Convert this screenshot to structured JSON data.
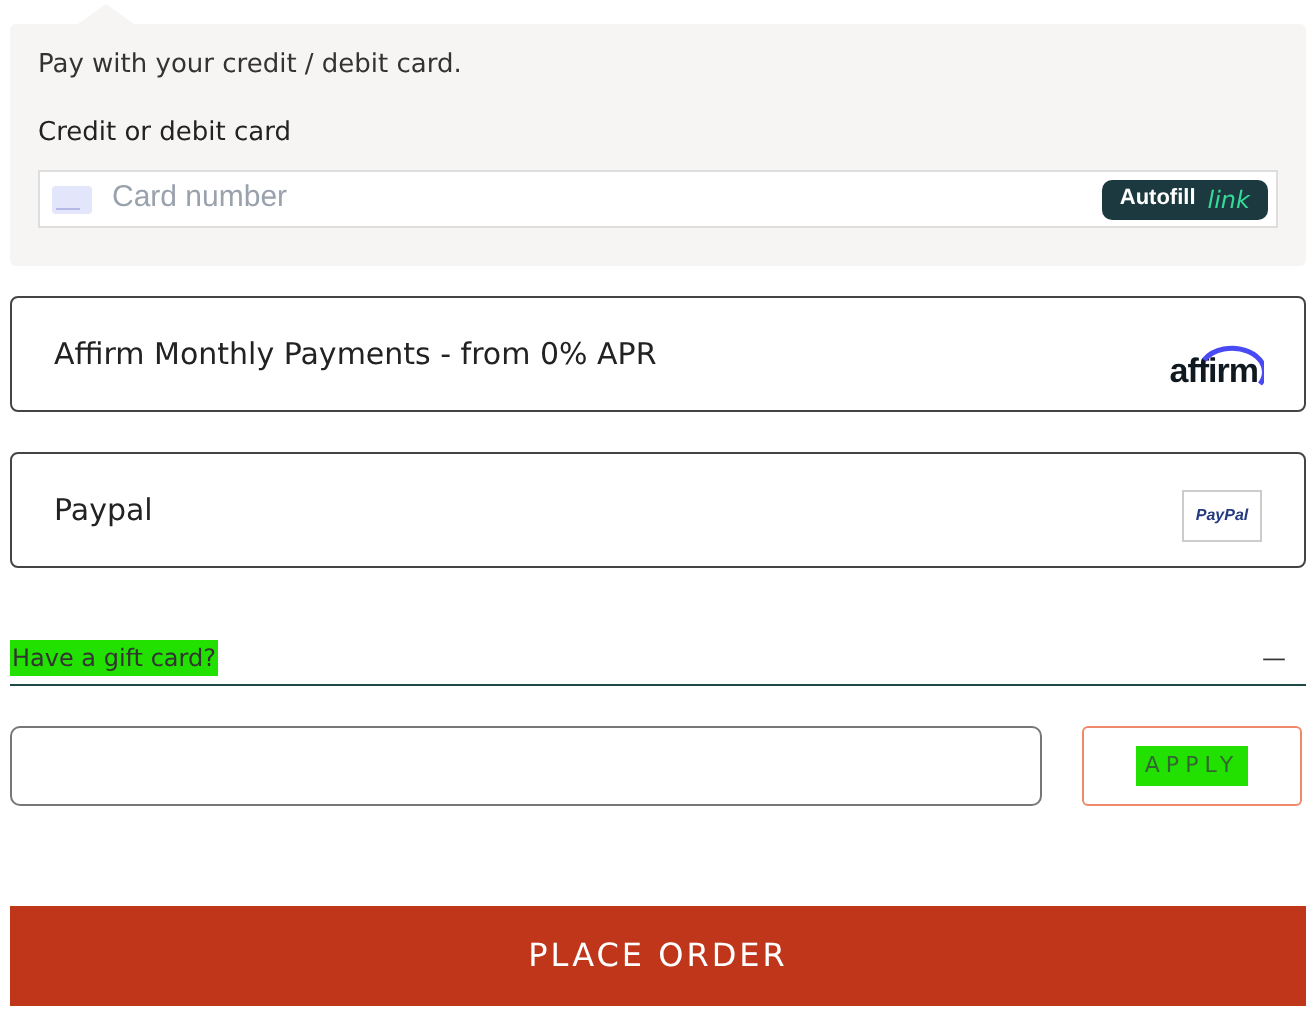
{
  "card_panel": {
    "intro": "Pay with your credit / debit card.",
    "label": "Credit or debit card",
    "placeholder": "Card number",
    "autofill": {
      "label": "Autofill",
      "brand": "link"
    }
  },
  "payment_options": [
    {
      "label": "Affirm Monthly Payments - from 0% APR",
      "kind": "affirm",
      "logo": "affirm"
    },
    {
      "label": "Paypal",
      "kind": "paypal",
      "logo": "PayPal"
    }
  ],
  "gift_card": {
    "label": "Have a gift card?",
    "highlighted": true,
    "toggle": "—",
    "apply": {
      "label": "APPLY",
      "highlighted": true
    }
  },
  "place_order": "PLACE ORDER"
}
